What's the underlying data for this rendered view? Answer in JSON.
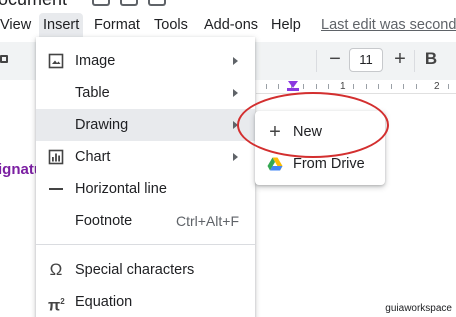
{
  "document": {
    "title": "ocument"
  },
  "menubar": {
    "items": [
      {
        "label": "View"
      },
      {
        "label": "Insert"
      },
      {
        "label": "Format"
      },
      {
        "label": "Tools"
      },
      {
        "label": "Add-ons"
      },
      {
        "label": "Help"
      }
    ],
    "last_edit": "Last edit was seconds"
  },
  "toolbar": {
    "minus": "−",
    "font_size": "11",
    "plus": "+",
    "bold": "B"
  },
  "ruler": {
    "labels": [
      "1",
      "2"
    ]
  },
  "insert_menu": {
    "items": [
      {
        "label": "Image",
        "icon": "image-icon"
      },
      {
        "label": "Table"
      },
      {
        "label": "Drawing"
      },
      {
        "label": "Chart",
        "icon": "chart-icon"
      },
      {
        "label": "Horizontal line",
        "icon": "horizontal-line-icon"
      },
      {
        "label": "Footnote",
        "shortcut": "Ctrl+Alt+F"
      },
      {
        "label": "Special characters",
        "icon": "omega-icon"
      },
      {
        "label": "Equation",
        "icon": "pi-icon"
      }
    ]
  },
  "drawing_submenu": {
    "items": [
      {
        "label": "New",
        "icon": "plus-icon"
      },
      {
        "label": "From Drive",
        "icon": "drive-icon"
      }
    ]
  },
  "page": {
    "text_fragment": "ignatu"
  },
  "watermark": "guiaworkspace",
  "colors": {
    "annotation": "#d32f2f",
    "accent_purple": "#8b38e0",
    "text_purple": "#7b1fa2"
  }
}
